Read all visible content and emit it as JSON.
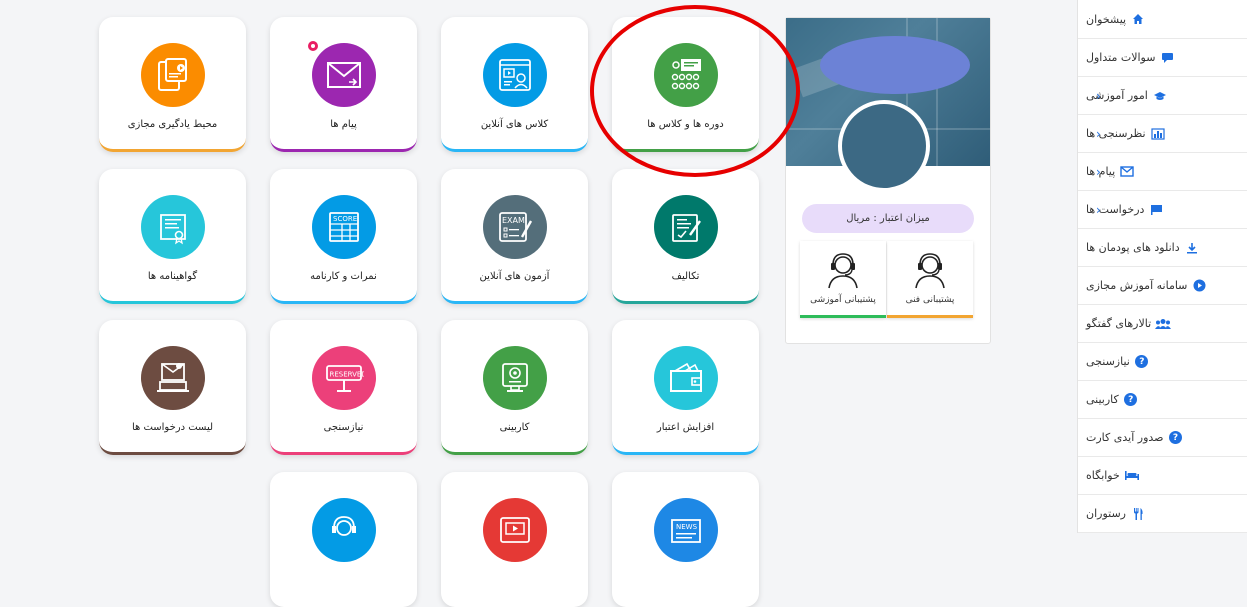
{
  "sidebar": {
    "items": [
      {
        "label": "پیشخوان",
        "icon": "home-icon",
        "chevron": false
      },
      {
        "label": "سوالات متداول",
        "icon": "chat-icon",
        "chevron": false
      },
      {
        "label": "امور آموزشی",
        "icon": "graduation-cap-icon",
        "chevron": true
      },
      {
        "label": "نظرسنجی ها",
        "icon": "bar-chart-icon",
        "chevron": true
      },
      {
        "label": "پیام ها",
        "icon": "envelope-icon",
        "chevron": true
      },
      {
        "label": "درخواست ها",
        "icon": "flag-icon",
        "chevron": true
      },
      {
        "label": "دانلود های پودمان ها",
        "icon": "download-icon",
        "chevron": false
      },
      {
        "label": "سامانه آموزش مجازی",
        "icon": "play-circle-icon",
        "chevron": false
      },
      {
        "label": "تالارهای گفتگو",
        "icon": "users-icon",
        "chevron": false
      },
      {
        "label": "نیازسنجی",
        "icon": "question-circle-icon",
        "chevron": false
      },
      {
        "label": "کاربینی",
        "icon": "question-circle-icon",
        "chevron": false
      },
      {
        "label": "صدور آیدی کارت",
        "icon": "question-circle-icon",
        "chevron": false
      },
      {
        "label": "خوابگاه",
        "icon": "bed-icon",
        "chevron": false
      },
      {
        "label": "رستوران",
        "icon": "utensils-icon",
        "chevron": false
      }
    ]
  },
  "profile": {
    "credit_label": "میزان اعتبار : مریال",
    "support_tech": "پشتیبانی فنی",
    "support_edu": "پشتیبانی آموزشی"
  },
  "tiles": [
    {
      "label": "دوره ها و کلاس ها",
      "color": "#43a047",
      "accent": "#43a047",
      "icon": "classroom-icon"
    },
    {
      "label": "کلاس های آنلاین",
      "color": "#039be5",
      "accent": "#29b6f6",
      "icon": "online-class-icon"
    },
    {
      "label": "پیام ها",
      "color": "#9c27b0",
      "accent": "#9c27b0",
      "icon": "mail-icon"
    },
    {
      "label": "محیط یادگیری مجازی",
      "color": "#fb8c00",
      "accent": "#f2a532",
      "icon": "ebook-icon"
    },
    {
      "label": "تکالیف",
      "color": "#00796b",
      "accent": "#26a69a",
      "icon": "assignment-icon"
    },
    {
      "label": "آزمون های آنلاین",
      "color": "#546e7a",
      "accent": "#29b6f6",
      "icon": "exam-icon"
    },
    {
      "label": "نمرات و کارنامه",
      "color": "#039be5",
      "accent": "#29b6f6",
      "icon": "score-icon"
    },
    {
      "label": "گواهینامه ها",
      "color": "#26c6da",
      "accent": "#26c6da",
      "icon": "certificate-icon"
    },
    {
      "label": "افزایش اعتبار",
      "color": "#26c6da",
      "accent": "#29b6f6",
      "icon": "wallet-icon"
    },
    {
      "label": "کاربینی",
      "color": "#43a047",
      "accent": "#43a047",
      "icon": "webcam-icon"
    },
    {
      "label": "نیازسنجی",
      "color": "#ec407a",
      "accent": "#ec407a",
      "icon": "reserved-sign-icon"
    },
    {
      "label": "لیست درخواست ها",
      "color": "#6d4c41",
      "accent": "#6d4c41",
      "icon": "mail-laptop-icon"
    },
    {
      "label": "",
      "color": "#1e88e5",
      "accent": "#1e88e5",
      "icon": "news-icon"
    },
    {
      "label": "",
      "color": "#e53935",
      "accent": "#e53935",
      "icon": "video-player-icon"
    },
    {
      "label": "",
      "color": "#039be5",
      "accent": "#039be5",
      "icon": "headset-icon"
    }
  ]
}
